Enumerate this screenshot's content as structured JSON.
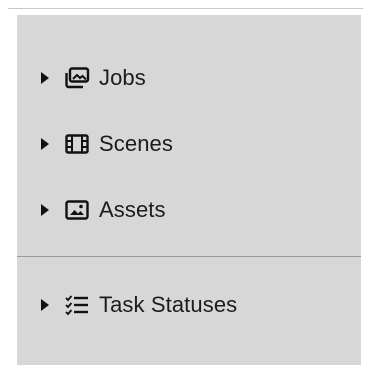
{
  "tree": {
    "items": [
      {
        "label": "Jobs",
        "icon": "photos-stack-icon"
      },
      {
        "label": "Scenes",
        "icon": "film-strip-icon"
      },
      {
        "label": "Assets",
        "icon": "image-icon"
      }
    ],
    "footer_items": [
      {
        "label": "Task Statuses",
        "icon": "checklist-icon"
      }
    ]
  },
  "colors": {
    "panel_background": "#d7d7d7",
    "text": "#1c1c1c",
    "divider": "#9a9a9a"
  }
}
